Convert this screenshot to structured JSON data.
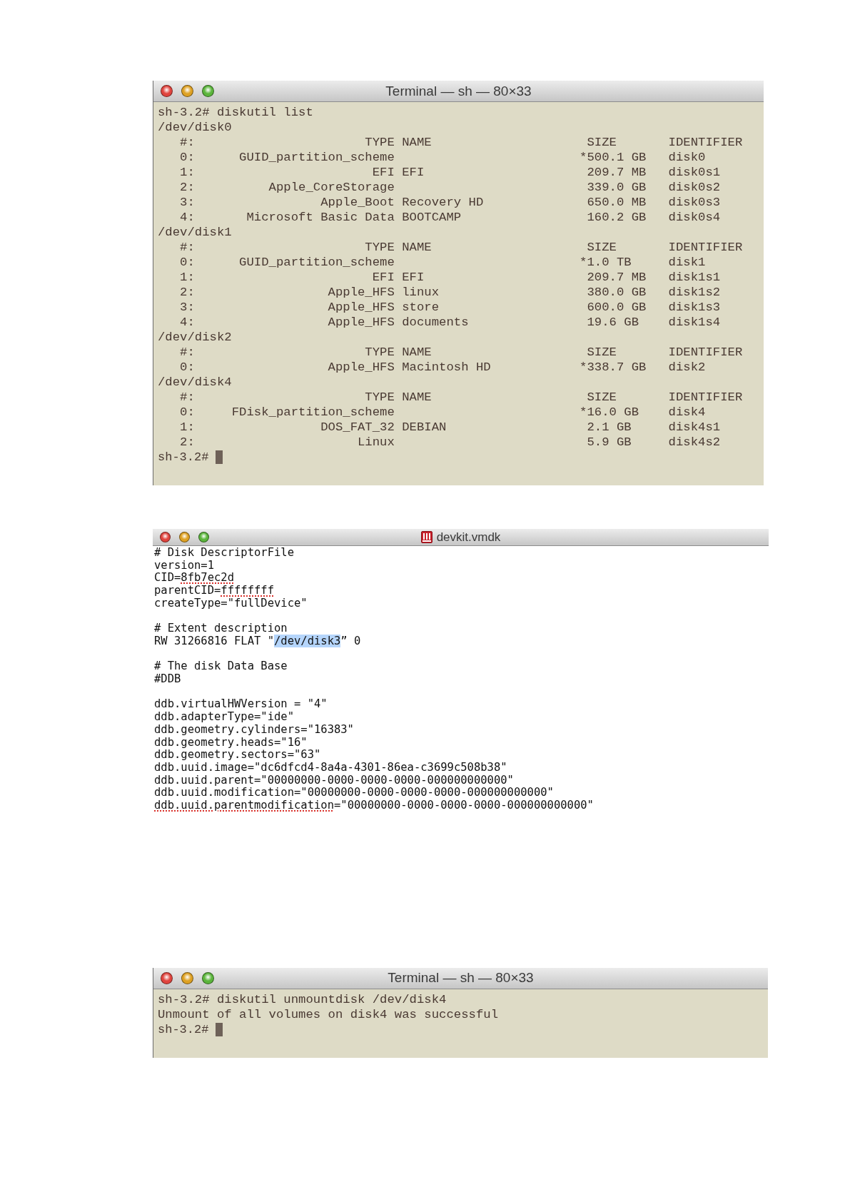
{
  "windows": [
    {
      "kind": "terminal",
      "title": "Terminal — sh — 80×33",
      "lines": [
        "sh-3.2# diskutil list",
        "/dev/disk0",
        "   #:                       TYPE NAME                     SIZE       IDENTIFIER",
        "   0:      GUID_partition_scheme                         *500.1 GB   disk0",
        "   1:                        EFI EFI                      209.7 MB   disk0s1",
        "   2:          Apple_CoreStorage                          339.0 GB   disk0s2",
        "   3:                 Apple_Boot Recovery HD              650.0 MB   disk0s3",
        "   4:       Microsoft Basic Data BOOTCAMP                 160.2 GB   disk0s4",
        "/dev/disk1",
        "   #:                       TYPE NAME                     SIZE       IDENTIFIER",
        "   0:      GUID_partition_scheme                         *1.0 TB     disk1",
        "   1:                        EFI EFI                      209.7 MB   disk1s1",
        "   2:                  Apple_HFS linux                    380.0 GB   disk1s2",
        "   3:                  Apple_HFS store                    600.0 GB   disk1s3",
        "   4:                  Apple_HFS documents                19.6 GB    disk1s4",
        "/dev/disk2",
        "   #:                       TYPE NAME                     SIZE       IDENTIFIER",
        "   0:                  Apple_HFS Macintosh HD            *338.7 GB   disk2",
        "/dev/disk4",
        "   #:                       TYPE NAME                     SIZE       IDENTIFIER",
        "   0:     FDisk_partition_scheme                         *16.0 GB    disk4",
        "   1:                 DOS_FAT_32 DEBIAN                   2.1 GB     disk4s1",
        "   2:                      Linux                          5.9 GB     disk4s2"
      ],
      "prompt": "sh-3.2#"
    },
    {
      "kind": "editor",
      "title": "devkit.vmdk",
      "blocks": [
        {
          "lines": [
            {
              "parts": [
                {
                  "text": "# Disk DescriptorFile",
                  "misspelled": false,
                  "selected": false
                }
              ]
            },
            {
              "parts": [
                {
                  "text": "version=1",
                  "misspelled": false,
                  "selected": false
                }
              ]
            },
            {
              "parts": [
                {
                  "text": "CID=",
                  "misspelled": false,
                  "selected": false
                },
                {
                  "text": "8fb7ec2d",
                  "misspelled": true,
                  "selected": false
                }
              ]
            },
            {
              "parts": [
                {
                  "text": "parentCID=",
                  "misspelled": false,
                  "selected": false
                },
                {
                  "text": "ffffffff",
                  "misspelled": true,
                  "selected": false
                }
              ]
            },
            {
              "parts": [
                {
                  "text": "createType=\"fullDevice\"",
                  "misspelled": false,
                  "selected": false
                }
              ]
            }
          ]
        },
        {
          "lines": [
            {
              "parts": [
                {
                  "text": "# Extent description",
                  "misspelled": false,
                  "selected": false
                }
              ]
            },
            {
              "parts": [
                {
                  "text": "RW 31266816 FLAT \"",
                  "misspelled": false,
                  "selected": false
                },
                {
                  "text": "/dev/disk3",
                  "misspelled": false,
                  "selected": true
                },
                {
                  "text": "” 0",
                  "misspelled": false,
                  "selected": false
                }
              ]
            }
          ]
        },
        {
          "lines": [
            {
              "parts": [
                {
                  "text": "# The disk Data Base",
                  "misspelled": false,
                  "selected": false
                }
              ]
            },
            {
              "parts": [
                {
                  "text": "#DDB",
                  "misspelled": false,
                  "selected": false
                }
              ]
            }
          ]
        },
        {
          "lines": [
            {
              "parts": [
                {
                  "text": "ddb.virtualHWVersion = \"4\"",
                  "misspelled": false,
                  "selected": false
                }
              ]
            },
            {
              "parts": [
                {
                  "text": "ddb.adapterType=\"ide\"",
                  "misspelled": false,
                  "selected": false
                }
              ]
            },
            {
              "parts": [
                {
                  "text": "ddb.geometry.cylinders=\"16383\"",
                  "misspelled": false,
                  "selected": false
                }
              ]
            },
            {
              "parts": [
                {
                  "text": "ddb.geometry.heads=\"16\"",
                  "misspelled": false,
                  "selected": false
                }
              ]
            },
            {
              "parts": [
                {
                  "text": "ddb.geometry.sectors=\"63\"",
                  "misspelled": false,
                  "selected": false
                }
              ]
            },
            {
              "parts": [
                {
                  "text": "ddb.uuid.image=\"dc6dfcd4-8a4a-4301-86ea-c3699c508b38\"",
                  "misspelled": false,
                  "selected": false
                }
              ]
            },
            {
              "parts": [
                {
                  "text": "ddb.uuid.parent=\"00000000-0000-0000-0000-000000000000\"",
                  "misspelled": false,
                  "selected": false
                }
              ]
            },
            {
              "parts": [
                {
                  "text": "ddb.uuid.modification=\"00000000-0000-0000-0000-000000000000\"",
                  "misspelled": false,
                  "selected": false
                }
              ]
            },
            {
              "parts": [
                {
                  "text": "ddb.uuid.parentmodification",
                  "misspelled": true,
                  "selected": false
                },
                {
                  "text": "=\"00000000-0000-0000-0000-000000000000\"",
                  "misspelled": false,
                  "selected": false
                }
              ]
            }
          ]
        }
      ]
    },
    {
      "kind": "terminal",
      "title": "Terminal — sh — 80×33",
      "lines": [
        "sh-3.2# diskutil unmountdisk /dev/disk4",
        "Unmount of all volumes on disk4 was successful"
      ],
      "prompt": "sh-3.2#"
    }
  ]
}
